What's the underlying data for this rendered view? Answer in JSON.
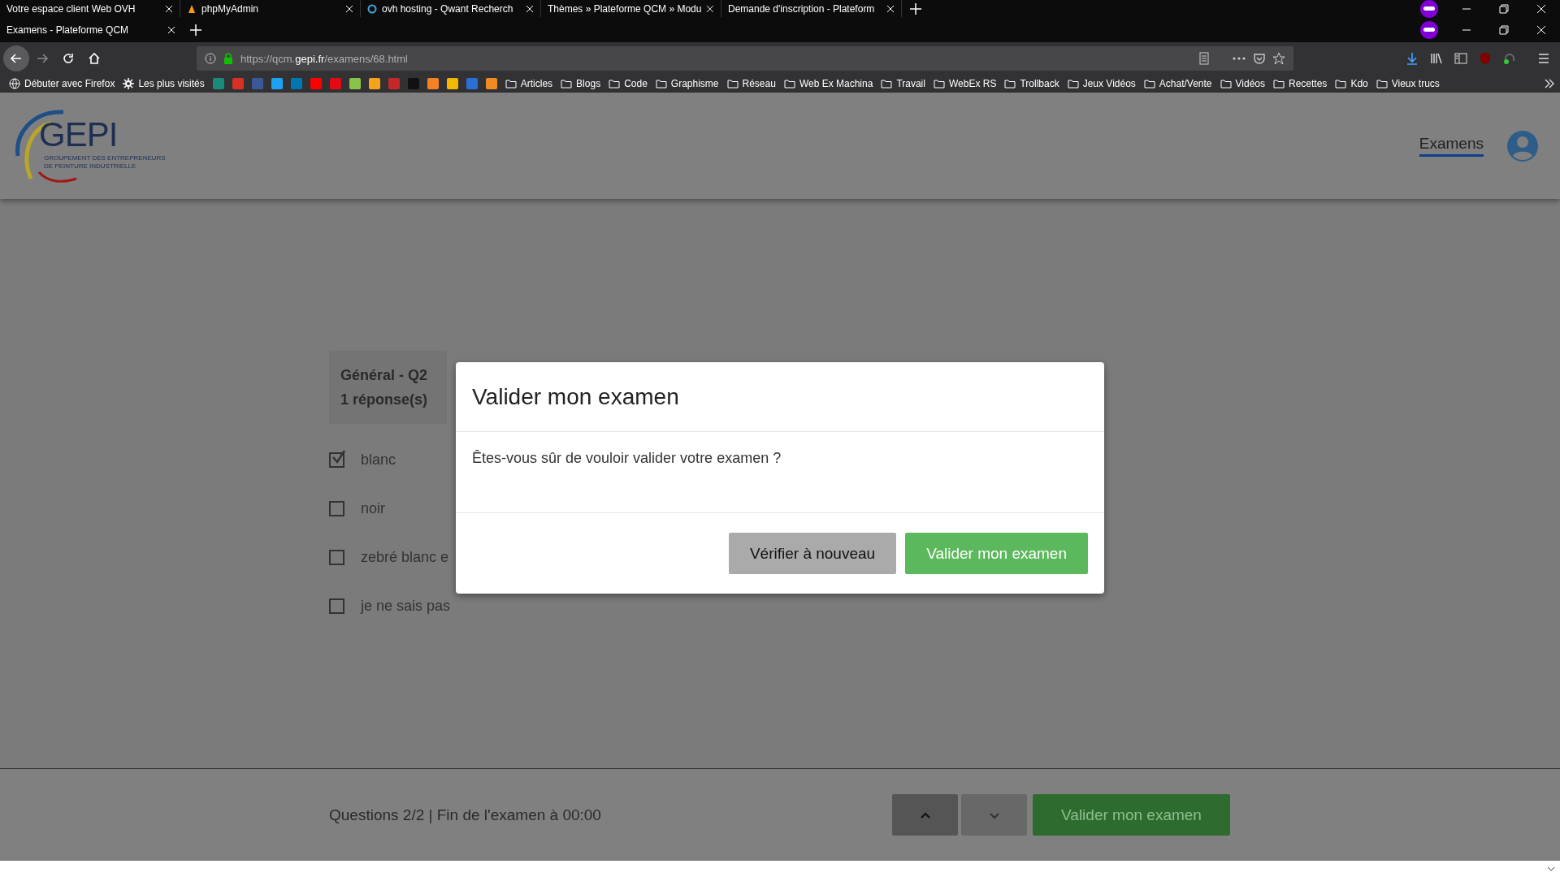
{
  "background_tabs": [
    {
      "title": "Votre espace client Web OVH",
      "kind": "plain"
    },
    {
      "title": "phpMyAdmin",
      "kind": "sail"
    },
    {
      "title": "ovh hosting - Qwant Recherch",
      "kind": "ring"
    },
    {
      "title": "Thèmes » Plateforme QCM » Modu",
      "kind": "plain"
    },
    {
      "title": "Demande d'inscription - Plateform",
      "kind": "plain"
    }
  ],
  "tabs": [
    {
      "title": "Examens - Plateforme QCM"
    }
  ],
  "address": "https://qcm.**gepi.fr**/examens/68.html",
  "bookmarks": [
    {
      "kind": "globe",
      "label": "Débuter avec Firefox"
    },
    {
      "kind": "gear",
      "label": "Les plus visités"
    },
    {
      "kind": "site",
      "color": "#1a8a7a"
    },
    {
      "kind": "site",
      "color": "#d93025"
    },
    {
      "kind": "site",
      "color": "#3b5998"
    },
    {
      "kind": "site",
      "color": "#1da1f2"
    },
    {
      "kind": "site",
      "color": "#0077b5"
    },
    {
      "kind": "site",
      "color": "#ff0000"
    },
    {
      "kind": "site",
      "color": "#e50914"
    },
    {
      "kind": "site",
      "color": "#8bc34a"
    },
    {
      "kind": "site",
      "color": "#f7a21b"
    },
    {
      "kind": "site",
      "color": "#c62828"
    },
    {
      "kind": "site",
      "color": "#111111"
    },
    {
      "kind": "site",
      "color": "#f58220"
    },
    {
      "kind": "site",
      "color": "#f2b700"
    },
    {
      "kind": "site",
      "color": "#2a6fd6"
    },
    {
      "kind": "site",
      "color": "#f08a24"
    },
    {
      "kind": "folder",
      "label": "Articles"
    },
    {
      "kind": "folder",
      "label": "Blogs"
    },
    {
      "kind": "folder",
      "label": "Code"
    },
    {
      "kind": "folder",
      "label": "Graphisme"
    },
    {
      "kind": "folder",
      "label": "Réseau"
    },
    {
      "kind": "folder",
      "label": "Web Ex Machina"
    },
    {
      "kind": "folder",
      "label": "Travail"
    },
    {
      "kind": "folder",
      "label": "WebEx RS"
    },
    {
      "kind": "folder",
      "label": "Trollback"
    },
    {
      "kind": "folder",
      "label": "Jeux Vidéos"
    },
    {
      "kind": "folder",
      "label": "Achat/Vente"
    },
    {
      "kind": "folder",
      "label": "Vidéos"
    },
    {
      "kind": "folder",
      "label": "Recettes"
    },
    {
      "kind": "folder",
      "label": "Kdo"
    },
    {
      "kind": "folder",
      "label": "Vieux trucs"
    }
  ],
  "site": {
    "logo": "GEPI",
    "tagline": [
      "GROUPEMENT DES ENTREPRENEURS",
      "DE PEINTURE INDUSTRIELLE"
    ],
    "nav": [
      {
        "label": "Examens",
        "selected": true
      }
    ]
  },
  "question": {
    "title": "Général - Q2",
    "subtitle": "1 réponse(s)",
    "answers": [
      {
        "label": "blanc",
        "checked": true
      },
      {
        "label": "noir",
        "checked": false
      },
      {
        "label": "zebré blanc e",
        "checked": false
      },
      {
        "label": "je ne sais pas",
        "checked": false
      }
    ]
  },
  "modal": {
    "title": "Valider mon examen",
    "message": "Êtes-vous sûr de vouloir valider votre examen ?",
    "buttons": [
      {
        "label": "Vérifier à nouveau",
        "kind": "secondary"
      },
      {
        "label": "Valider mon examen",
        "kind": "success"
      }
    ]
  },
  "footer": {
    "status": "Questions 2/2 | Fin de l'examen à 00:00",
    "buttons": [
      {
        "kind": "up"
      },
      {
        "kind": "down"
      },
      {
        "kind": "submit",
        "label": "Valider mon examen"
      }
    ]
  }
}
